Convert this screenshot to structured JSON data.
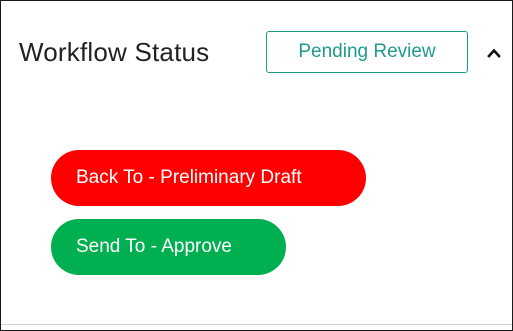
{
  "workflow": {
    "title": "Workflow Status",
    "status": "Pending Review",
    "collapse_icon": "chevron-up-icon"
  },
  "actions": [
    {
      "label": "Back To - Preliminary Draft",
      "color": "#ff0000"
    },
    {
      "label": "Send To - Approve",
      "color": "#00b050"
    }
  ],
  "colors": {
    "status_accent": "#1f9a8e",
    "back_button": "#ff0000",
    "send_button": "#00b050"
  }
}
